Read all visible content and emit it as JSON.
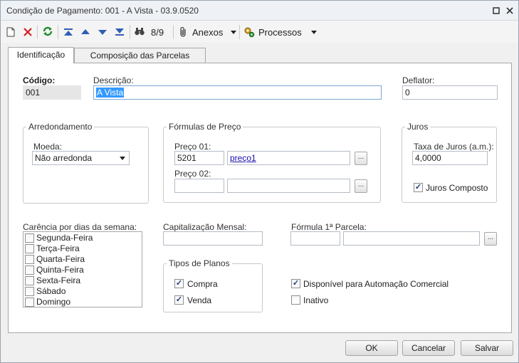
{
  "window": {
    "title": "Condição de Pagamento: 001 - A Vista - 03.9.0520"
  },
  "toolbar": {
    "record_counter": "8/9",
    "anexos_label": "Anexos",
    "processos_label": "Processos"
  },
  "tabs": [
    {
      "label": "Identificação"
    },
    {
      "label": "Composição das Parcelas"
    }
  ],
  "codigo": {
    "label": "Código:",
    "value": "001"
  },
  "descricao": {
    "label": "Descrição:",
    "value": "A Vista"
  },
  "deflator": {
    "label": "Deflator:",
    "value": "0"
  },
  "arredondamento": {
    "label": "Arredondamento",
    "moeda_label": "Moeda:",
    "moeda_value": "Não arredonda"
  },
  "formulas": {
    "label": "Fórmulas de Preço",
    "preco01_label": "Preço 01:",
    "preco01_code": "5201",
    "preco01_name": "preço1",
    "preco02_label": "Preço 02:",
    "preco02_code": "",
    "preco02_name": ""
  },
  "juros": {
    "label": "Juros",
    "taxa_label": "Taxa de Juros (a.m.):",
    "taxa_value": "4,0000",
    "composto_label": "Juros Composto"
  },
  "carencia": {
    "label": "Carência por dias da semana:",
    "days": [
      "Segunda-Feira",
      "Terça-Feira",
      "Quarta-Feira",
      "Quinta-Feira",
      "Sexta-Feira",
      "Sábado",
      "Domingo"
    ]
  },
  "capitalizacao": {
    "label": "Capitalização Mensal:",
    "value": ""
  },
  "formula_parcela": {
    "label": "Fórmula 1ª Parcela:",
    "code": "",
    "name": ""
  },
  "tipos_planos": {
    "label": "Tipos de Planos",
    "compra_label": "Compra",
    "venda_label": "Venda"
  },
  "flags": {
    "automacao_label": "Disponível para Automação Comercial",
    "inativo_label": "Inativo"
  },
  "footer": {
    "ok_label": "OK",
    "cancelar_label": "Cancelar",
    "salvar_label": "Salvar"
  }
}
